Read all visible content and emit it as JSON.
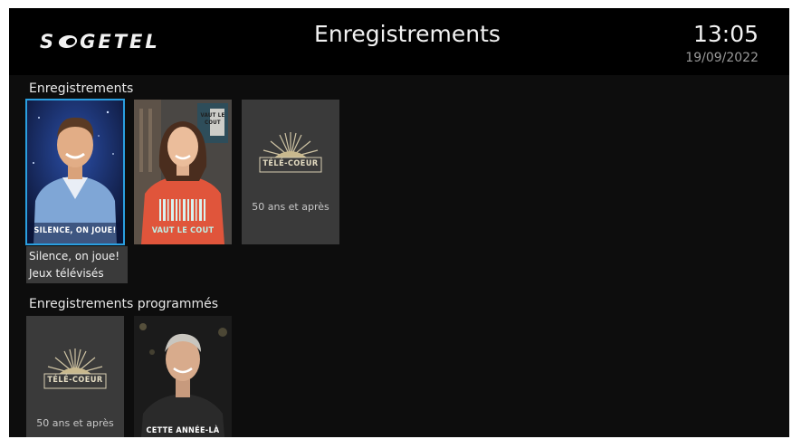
{
  "header": {
    "logo_text": "SOGETEL",
    "logo_left": "S",
    "logo_right": "GETEL",
    "title": "Enregistrements",
    "time": "13:05",
    "date": "19/09/2022"
  },
  "sections": {
    "recordings": {
      "title": "Enregistrements",
      "items": [
        {
          "poster_text": "SILENCE, ON JOUE!",
          "icon": "silence-on-joue-poster"
        },
        {
          "poster_text_top": "VAUT LE COUT",
          "poster_text": "VAUT LE COUT",
          "icon": "vaut-le-cout-poster"
        },
        {
          "caption": "50 ans et après",
          "icon": "tele-coeur-logo"
        }
      ],
      "selected": {
        "name": "Silence, on joue!",
        "genre": "Jeux télévisés"
      }
    },
    "scheduled": {
      "title": "Enregistrements programmés",
      "items": [
        {
          "caption": "50 ans et après",
          "icon": "tele-coeur-logo"
        },
        {
          "poster_text": "CETTE ANNÉE-LÀ",
          "icon": "cette-annee-la-poster"
        }
      ]
    }
  },
  "tele_coeur_text": "TÉLÉ-COEUR",
  "colors": {
    "background": "#0d0d0d",
    "header": "#000000",
    "tile": "#3a3a3a",
    "selection": "#2a9fe0"
  }
}
